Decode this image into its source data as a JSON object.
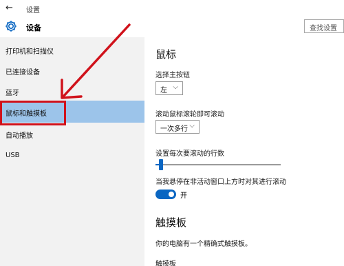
{
  "window": {
    "back_glyph": "←",
    "title": "设置"
  },
  "header": {
    "icon": "gear-icon",
    "title": "设备",
    "search_placeholder": "查找设置"
  },
  "sidebar": {
    "items": [
      {
        "label": "打印机和扫描仪",
        "selected": false
      },
      {
        "label": "已连接设备",
        "selected": false
      },
      {
        "label": "蓝牙",
        "selected": false
      },
      {
        "label": "鼠标和触摸板",
        "selected": true
      },
      {
        "label": "自动播放",
        "selected": false
      },
      {
        "label": "USB",
        "selected": false
      }
    ]
  },
  "annotation": {
    "color": "#d0121b"
  },
  "mouse": {
    "heading": "鼠标",
    "primary_button_label": "选择主按钮",
    "primary_button_value": "左",
    "wheel_label": "滚动鼠标滚轮即可滚动",
    "wheel_value": "一次多行",
    "lines_label": "设置每次要滚动的行数",
    "lines_level_fraction": 0.03,
    "inactive_scroll_label": "当我悬停在非活动窗口上方时对其进行滚动",
    "inactive_scroll_state": "开",
    "inactive_scroll_on": true
  },
  "touchpad": {
    "heading": "触摸板",
    "description": "你的电脑有一个精确式触摸板。",
    "subheading": "触摸板"
  },
  "colors": {
    "accent": "#0a66c2",
    "selected_bg": "#9cc4ea",
    "sidebar_bg": "#f2f2f2"
  }
}
